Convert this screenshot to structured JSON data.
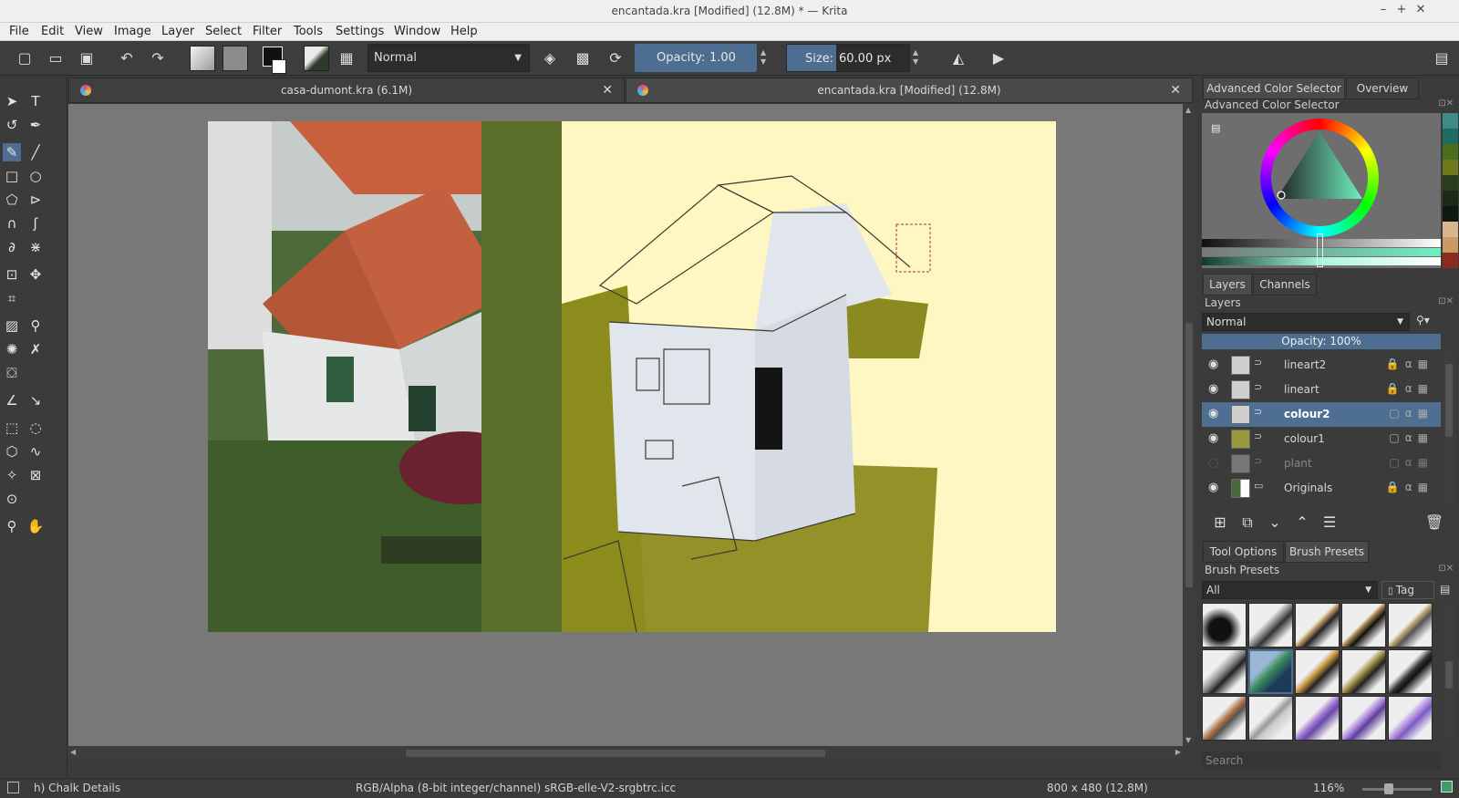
{
  "window": {
    "title": "encantada.kra [Modified]  (12.8M) * — Krita"
  },
  "menu": [
    "File",
    "Edit",
    "View",
    "Image",
    "Layer",
    "Select",
    "Filter",
    "Tools",
    "Settings",
    "Window",
    "Help"
  ],
  "toolbar": {
    "blend_mode": "Normal",
    "opacity_label": "Opacity:",
    "opacity_value": "1.00",
    "size_label": "Size:",
    "size_value": "60.00 px"
  },
  "tabs": [
    {
      "label": "casa-dumont.kra (6.1M)"
    },
    {
      "label": "encantada.kra [Modified]  (12.8M)"
    }
  ],
  "right_dock": {
    "color_tabs": [
      "Advanced Color Selector",
      "Overview"
    ],
    "color_title": "Advanced Color Selector",
    "swatches": [
      "#3d8b86",
      "#1f6b63",
      "#4a6d1e",
      "#6e7a1a",
      "#2a3d1c",
      "#1c2b14",
      "#0e1a10",
      "#d9b58b",
      "#c79a66",
      "#8b2a1f"
    ],
    "layers_tabs": [
      "Layers",
      "Channels"
    ],
    "layers_title": "Layers",
    "layers_blend": "Normal",
    "layers_opacity": "Opacity:  100%",
    "layers": [
      {
        "name": "lineart2",
        "visible": true,
        "selected": false
      },
      {
        "name": "lineart",
        "visible": true,
        "selected": false
      },
      {
        "name": "colour2",
        "visible": true,
        "selected": true
      },
      {
        "name": "colour1",
        "visible": true,
        "selected": false
      },
      {
        "name": "plant",
        "visible": false,
        "selected": false
      },
      {
        "name": "Originals",
        "visible": true,
        "selected": false
      }
    ],
    "preset_tabs": [
      "Tool Options",
      "Brush Presets"
    ],
    "presets_title": "Brush Presets",
    "presets_filter": "All",
    "presets_tag": "Tag",
    "presets_search": "Search"
  },
  "status": {
    "brush": "h) Chalk Details",
    "colorspace": "RGB/Alpha (8-bit integer/channel)  sRGB-elle-V2-srgbtrc.icc",
    "dimensions": "800 x 480 (12.8M)",
    "zoom": "116%"
  }
}
